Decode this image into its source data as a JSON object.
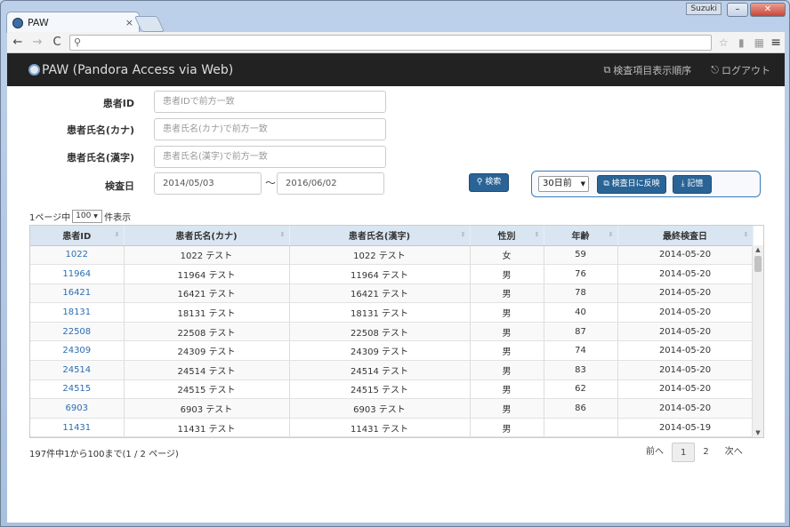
{
  "browser": {
    "tab_title": "PAW",
    "tab_close": "×",
    "user_badge": "Suzuki",
    "win_min": "–",
    "win_max": "□",
    "win_close": "✕",
    "nav": {
      "back": "←",
      "forward": "→",
      "reload": "C"
    },
    "url": "",
    "search_glyph": "⚲",
    "menu_glyph": "≡"
  },
  "navbar": {
    "brand": "PAW (Pandora Access via Web)",
    "display_order_glyph": "⧉",
    "display_order": "検査項目表示順序",
    "logout_glyph": "⎋",
    "logout": "ログアウト"
  },
  "form": {
    "patient_id_label": "患者ID",
    "patient_id_placeholder": "患者IDで前方一致",
    "kana_label": "患者氏名(カナ)",
    "kana_placeholder": "患者氏名(カナ)で前方一致",
    "kanji_label": "患者氏名(漢字)",
    "kanji_placeholder": "患者氏名(漢字)で前方一致",
    "date_label": "検査日",
    "date_from": "2014/05/03",
    "date_sep": "〜",
    "date_to": "2016/06/02",
    "search_button": "検索",
    "search_glyph": "⚲"
  },
  "quick": {
    "period_value": "30日前",
    "period_arrow": "▼",
    "apply_button": "検査日に反映",
    "apply_glyph": "⧉",
    "remember_button": "記憶",
    "remember_glyph": "⤓"
  },
  "perpage": {
    "prefix": "1ページ中",
    "value": "100",
    "arrow": "▼",
    "suffix": "件表示"
  },
  "table": {
    "sort_glyph": "⇕",
    "headers": [
      "患者ID",
      "患者氏名(カナ)",
      "患者氏名(漢字)",
      "性別",
      "年齢",
      "最終検査日"
    ],
    "rows": [
      [
        "1022",
        "1022 テスト",
        "1022 テスト",
        "女",
        "59",
        "2014-05-20"
      ],
      [
        "11964",
        "11964 テスト",
        "11964 テスト",
        "男",
        "76",
        "2014-05-20"
      ],
      [
        "16421",
        "16421 テスト",
        "16421 テスト",
        "男",
        "78",
        "2014-05-20"
      ],
      [
        "18131",
        "18131 テスト",
        "18131 テスト",
        "男",
        "40",
        "2014-05-20"
      ],
      [
        "22508",
        "22508 テスト",
        "22508 テスト",
        "男",
        "87",
        "2014-05-20"
      ],
      [
        "24309",
        "24309 テスト",
        "24309 テスト",
        "男",
        "74",
        "2014-05-20"
      ],
      [
        "24514",
        "24514 テスト",
        "24514 テスト",
        "男",
        "83",
        "2014-05-20"
      ],
      [
        "24515",
        "24515 テスト",
        "24515 テスト",
        "男",
        "62",
        "2014-05-20"
      ],
      [
        "6903",
        "6903 テスト",
        "6903 テスト",
        "男",
        "86",
        "2014-05-20"
      ],
      [
        "11431",
        "11431 テスト",
        "11431 テスト",
        "男",
        "",
        "2014-05-19"
      ]
    ]
  },
  "summary": "197件中1から100まで(1 / 2 ページ)",
  "pager": {
    "prev": "前へ",
    "page1": "1",
    "page2": "2",
    "next": "次へ"
  }
}
